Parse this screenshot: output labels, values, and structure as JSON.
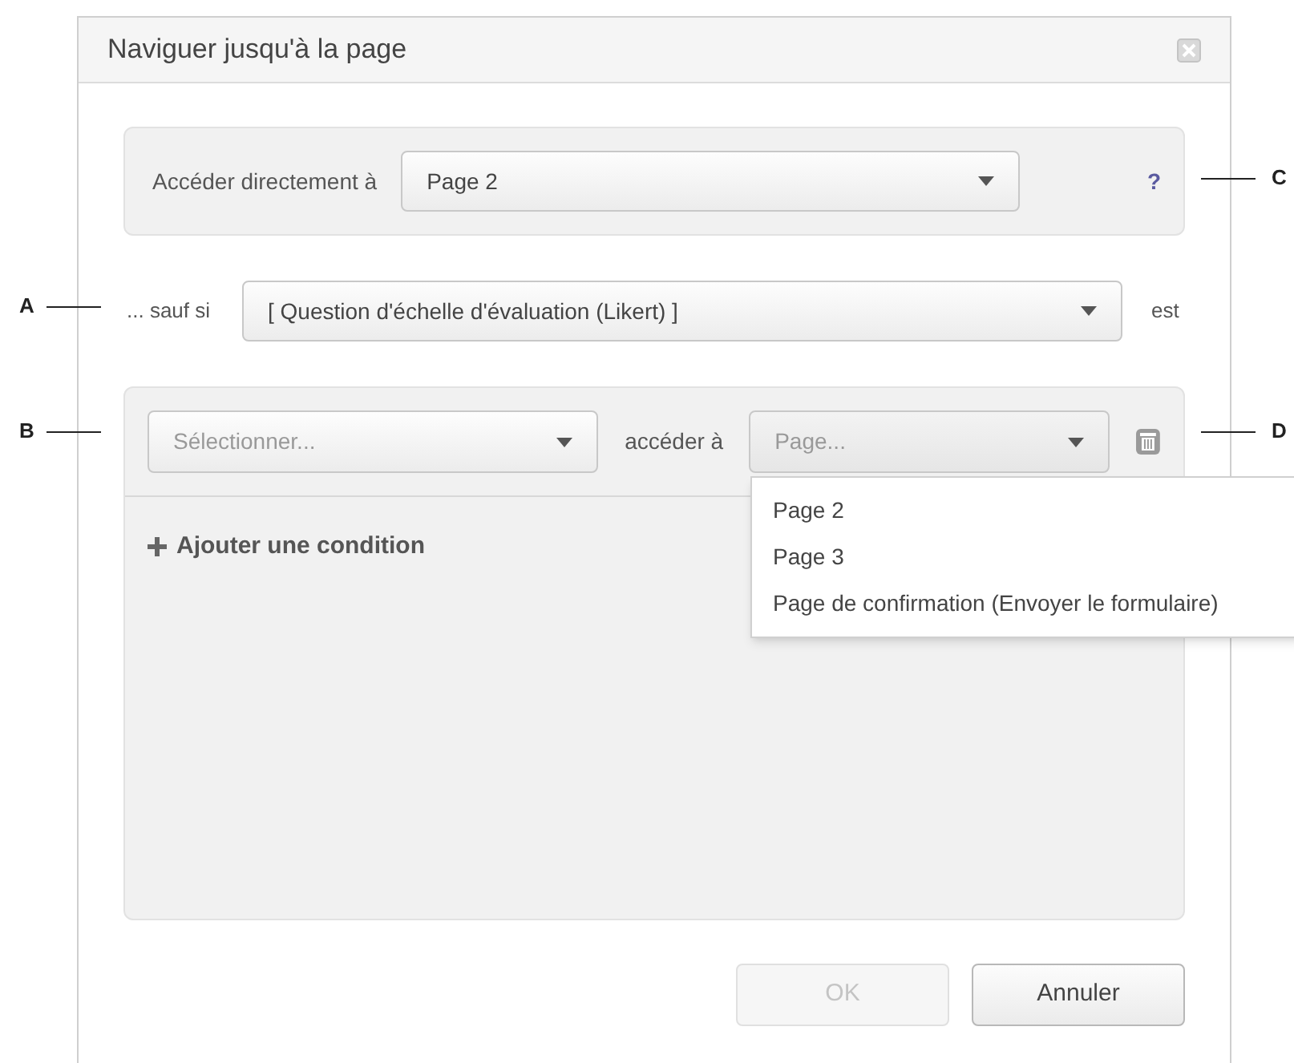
{
  "dialog": {
    "title": "Naviguer jusqu'à la page"
  },
  "direct": {
    "label": "Accéder directement à",
    "value": "Page 2",
    "help": "?"
  },
  "unless": {
    "label": "... sauf si",
    "value": "[ Question d'échelle d'évaluation (Likert) ]",
    "suffix": "est"
  },
  "conditions": [
    {
      "field_placeholder": "Sélectionner...",
      "connector": "accéder à",
      "target_placeholder": "Page..."
    }
  ],
  "target_menu": [
    {
      "label": "Page 2",
      "selected": false
    },
    {
      "label": "Page 3",
      "selected": false
    },
    {
      "label": "Page de confirmation (Envoyer le formulaire)",
      "selected": false
    }
  ],
  "add_condition": {
    "label": "Ajouter une condition"
  },
  "buttons": [
    {
      "label": "OK",
      "disabled": true
    },
    {
      "label": "Annuler",
      "disabled": false
    }
  ],
  "callouts_left": [
    {
      "letter": "A"
    },
    {
      "letter": "B"
    }
  ],
  "callouts_right": [
    {
      "letter": "C"
    },
    {
      "letter": "D"
    }
  ]
}
